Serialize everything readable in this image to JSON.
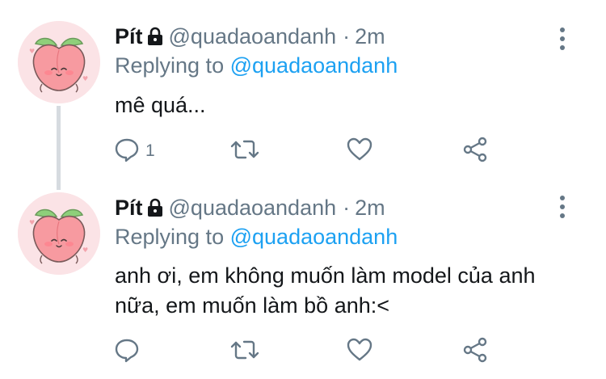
{
  "tweets": [
    {
      "name": "Pít",
      "handle": "@quadaoandanh",
      "separator": "·",
      "time": "2m",
      "replying_prefix": "Replying to",
      "replying_to": "@quadaoandanh",
      "text": "mê quá...",
      "reply_count": "1"
    },
    {
      "name": "Pít",
      "handle": "@quadaoandanh",
      "separator": "·",
      "time": "2m",
      "replying_prefix": "Replying to",
      "replying_to": "@quadaoandanh",
      "text": "anh ơi, em không muốn làm model của anh nữa, em muốn làm bồ anh:<",
      "reply_count": ""
    }
  ],
  "icons": {
    "lock": "lock-icon",
    "more": "more-vertical-icon",
    "reply": "reply-icon",
    "retweet": "retweet-icon",
    "like": "heart-icon",
    "share": "share-icon"
  },
  "colors": {
    "text": "#14171a",
    "muted": "#657786",
    "link": "#1da1f2",
    "avatar_bg": "#fbe3e6",
    "peach": "#f5868e"
  }
}
